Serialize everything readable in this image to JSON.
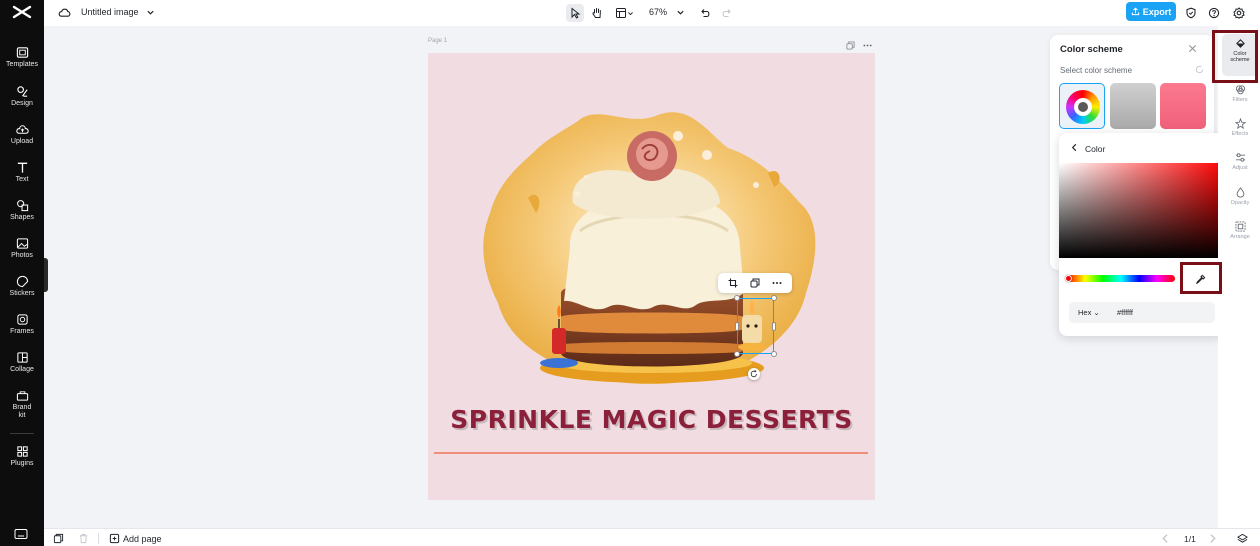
{
  "nav": {
    "items": [
      {
        "label": "Templates",
        "icon": "templates-icon"
      },
      {
        "label": "Design",
        "icon": "design-icon"
      },
      {
        "label": "Upload",
        "icon": "upload-icon"
      },
      {
        "label": "Text",
        "icon": "text-icon"
      },
      {
        "label": "Shapes",
        "icon": "shapes-icon"
      },
      {
        "label": "Photos",
        "icon": "photos-icon"
      },
      {
        "label": "Stickers",
        "icon": "stickers-icon"
      },
      {
        "label": "Frames",
        "icon": "frames-icon"
      },
      {
        "label": "Collage",
        "icon": "collage-icon"
      },
      {
        "label": "Brand\nkit",
        "icon": "brand-kit-icon"
      },
      {
        "label": "Plugins",
        "icon": "plugins-icon"
      }
    ]
  },
  "header": {
    "doc_title": "Untitled image",
    "zoom": "67%",
    "export_label": "Export",
    "accent": "#1aa3f5"
  },
  "canvas": {
    "page_label": "Page 1",
    "headline": "SPRINKLE MAGIC DESSERTS",
    "bg_color": "#f1dde1",
    "headline_color": "#8c1f3a",
    "rule_color": "#ee8f79"
  },
  "color_scheme_panel": {
    "title": "Color scheme",
    "subtitle": "Select color scheme"
  },
  "color_panel": {
    "title": "Color",
    "hex_mode": "Hex",
    "hex_value": "#ffffff"
  },
  "right_rail": {
    "items": [
      {
        "label": "Color\nscheme",
        "icon": "paint-bucket-icon"
      },
      {
        "label": "Filters",
        "icon": "filters-icon"
      },
      {
        "label": "Effects",
        "icon": "effects-icon"
      },
      {
        "label": "Adjust",
        "icon": "adjust-icon"
      },
      {
        "label": "Opacity",
        "icon": "opacity-icon"
      },
      {
        "label": "Arrange",
        "icon": "arrange-icon"
      }
    ]
  },
  "footer": {
    "add_page": "Add page",
    "page_count": "1/1"
  }
}
